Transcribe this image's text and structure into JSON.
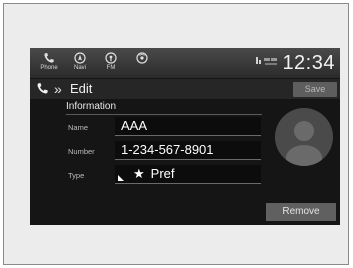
{
  "topbar": {
    "apps": [
      {
        "label": "Phone",
        "icon": "phone-icon"
      },
      {
        "label": "Navi",
        "icon": "navi-icon"
      },
      {
        "label": "FM",
        "icon": "radio-icon"
      },
      {
        "label": "",
        "icon": "satellite-radio-icon"
      }
    ],
    "clock": "12:34"
  },
  "header": {
    "title": "Edit",
    "save_label": "Save"
  },
  "form": {
    "section_title": "Information",
    "name_label": "Name",
    "name_value": "AAA",
    "number_label": "Number",
    "number_value": "1-234-567-8901",
    "type_label": "Type",
    "type_value": "Pref"
  },
  "remove_label": "Remove"
}
